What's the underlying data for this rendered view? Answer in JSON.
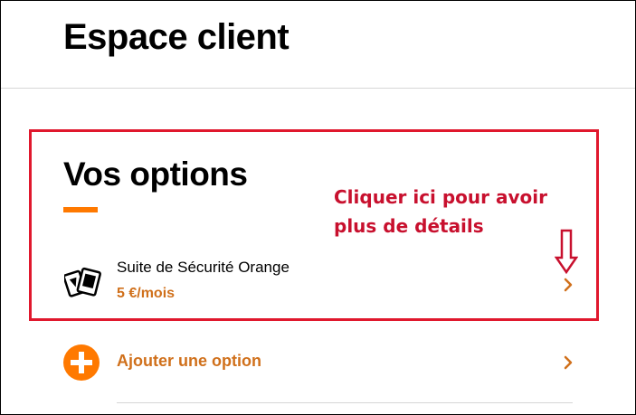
{
  "header": {
    "title": "Espace client"
  },
  "options_section": {
    "title": "Vos options",
    "items": [
      {
        "icon": "security-cards-icon",
        "name": "Suite de Sécurité Orange",
        "price": "5 €/mois"
      }
    ],
    "add_option_label": "Ajouter une option"
  },
  "annotation": {
    "line1": "Cliquer ici pour avoir",
    "line2": "plus de détails"
  },
  "colors": {
    "accent_orange": "#ff7900",
    "price_orange": "#d0701b",
    "annotation_red": "#c8102e",
    "highlight_border": "#e0182d"
  }
}
